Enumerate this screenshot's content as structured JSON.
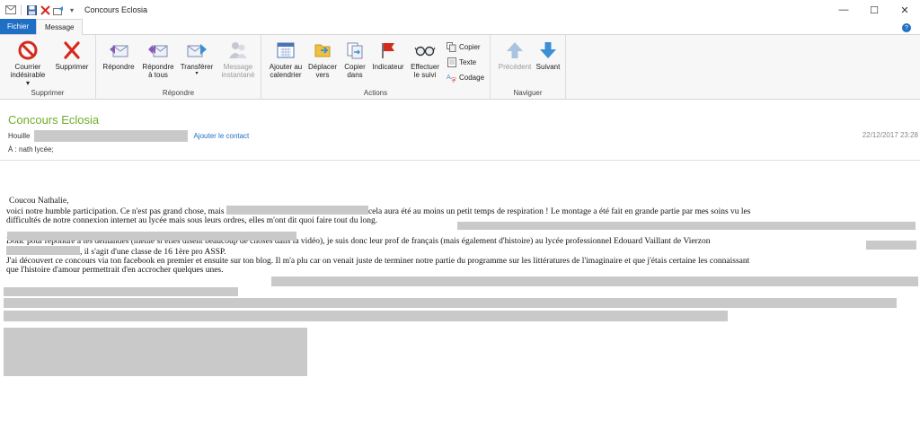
{
  "window": {
    "title": "Concours Eclosia",
    "qat_dropdown": "▾",
    "controls": {
      "minimize": "—",
      "maximize": "☐",
      "close": "✕"
    }
  },
  "tabs": [
    {
      "label": "Fichier"
    },
    {
      "label": "Message"
    }
  ],
  "help": "?",
  "ribbon": {
    "groups": {
      "supprimer": {
        "label": "Supprimer",
        "junk": {
          "line1": "Courrier",
          "line2": "indésirable ▾"
        },
        "delete": {
          "line1": "Supprimer"
        }
      },
      "repondre": {
        "label": "Répondre",
        "reply": {
          "line1": "Répondre"
        },
        "reply_all": {
          "line1": "Répondre",
          "line2": "à tous"
        },
        "forward": {
          "line1": "Transférer",
          "line2": "▾"
        },
        "im": {
          "line1": "Message",
          "line2": "instantané"
        }
      },
      "actions": {
        "label": "Actions",
        "add_calendar": {
          "line1": "Ajouter au",
          "line2": "calendrier"
        },
        "move": {
          "line1": "Déplacer",
          "line2": "vers"
        },
        "copy_to": {
          "line1": "Copier",
          "line2": "dans"
        },
        "flag": {
          "line1": "Indicateur"
        },
        "followup": {
          "line1": "Effectuer",
          "line2": "le suivi"
        },
        "copy": "Copier",
        "text": "Texte",
        "encoding": "Codage"
      },
      "naviguer": {
        "label": "Naviguer",
        "previous": {
          "line1": "Précédent"
        },
        "next": {
          "line1": "Suivant"
        }
      }
    }
  },
  "message": {
    "subject": "Concours Eclosia",
    "from_name": "Houille",
    "add_contact": "Ajouter le contact",
    "date": "22/12/2017 23:28",
    "to": "À : nath lycée;",
    "body": {
      "greeting": "Coucou Nathalie,",
      "p1a": "voici notre humble participation. Ce n'est pas grand chose, mais",
      "p1b": "cela aura été au moins un petit temps de respiration ! Le montage a été fait en grande partie par mes soins vu les",
      "p1c": "difficultés de notre connexion internet au lycée mais sous leurs ordres, elles m'ont dit quoi faire tout du long.",
      "p2a": "Donc pour répondre à tes demandes (même si elles disent beaucoup de choses dans la vidéo), je suis donc leur prof de français (mais également d'histoire) au lycée professionnel Edouard Vaillant de Vierzon",
      "p2b": ", il s'agit d'une classe de 16 1ère pro ASSP.",
      "p3a": "J'ai découvert ce concours via ton facebook en premier et ensuite sur ton blog. Il m'a plu car on venait juste de terminer notre partie du programme sur les littératures de l'imaginaire et que j'étais certaine les connaissant",
      "p3b": "que l'histoire d'amour permettrait d'en accrocher quelques unes."
    }
  },
  "colors": {
    "file_tab": "#1f6fc5",
    "subject": "#6fae28",
    "link": "#1f6fc5",
    "redaction": "#c9c9c9"
  }
}
